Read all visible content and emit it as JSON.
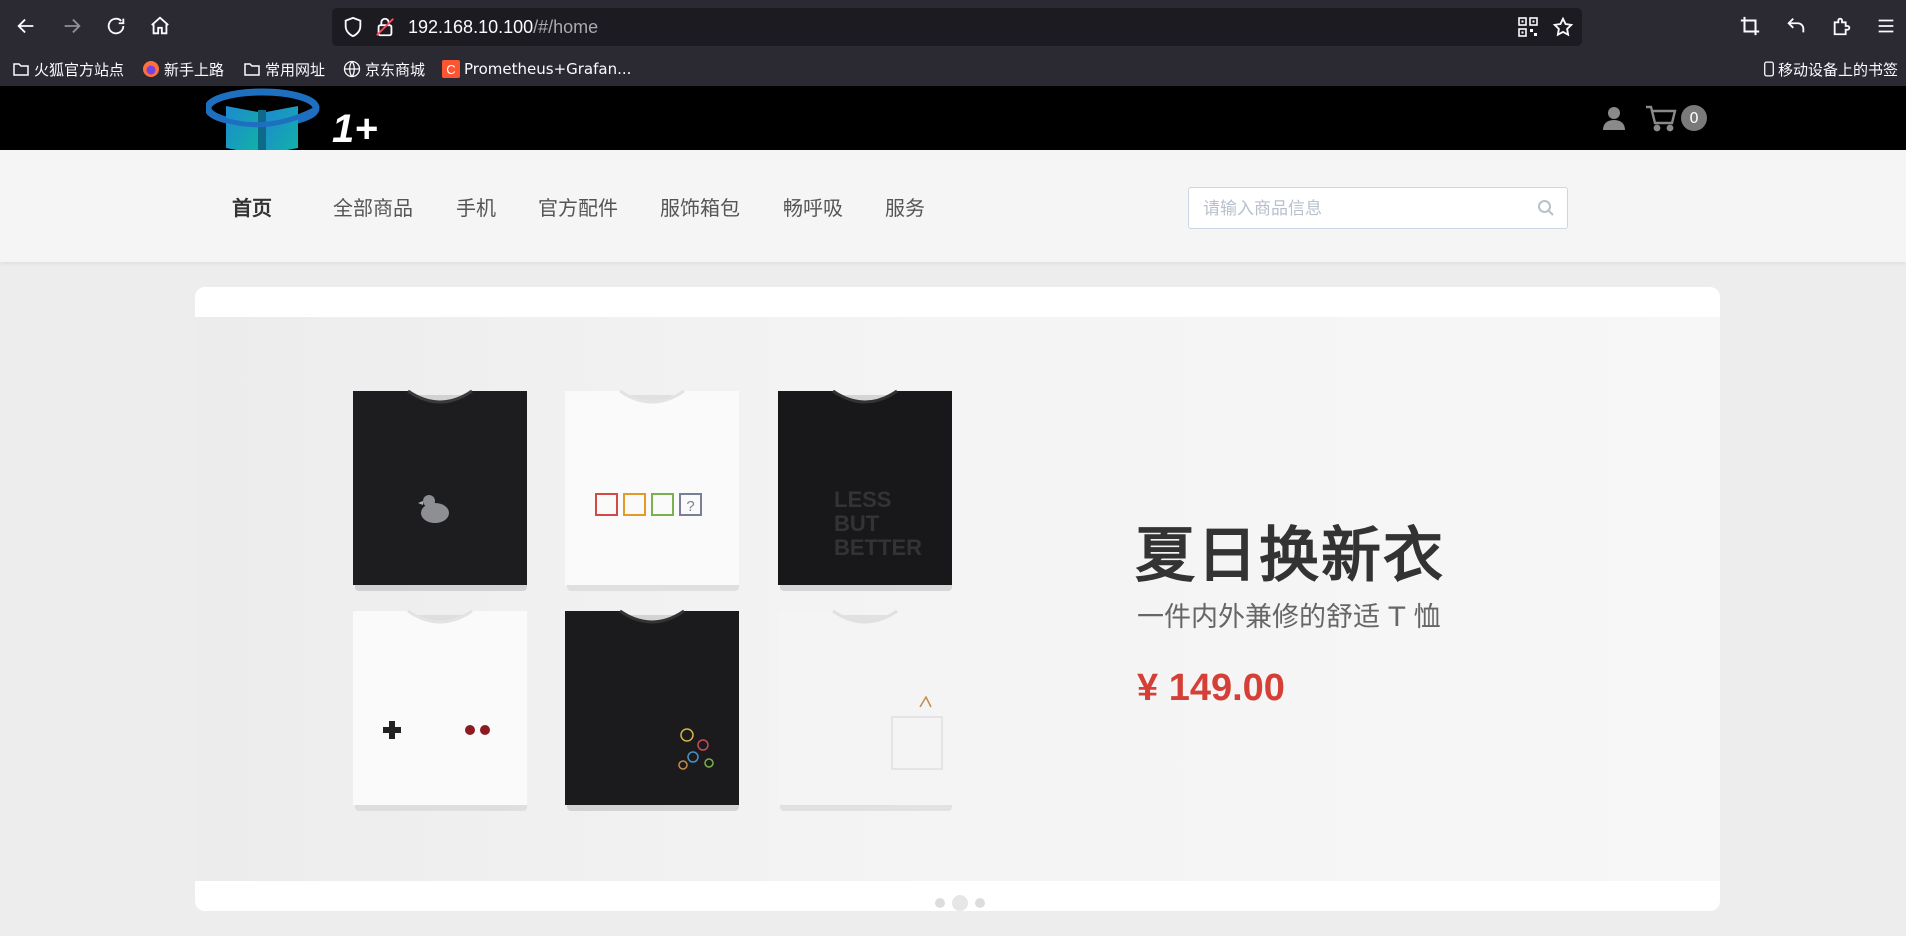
{
  "browser": {
    "url_host": "192.168.10.100",
    "url_path": "/#/home",
    "bookmarks": [
      "火狐官方站点",
      "新手上路",
      "常用网址",
      "京东商城",
      "Prometheus+Grafan..."
    ],
    "mobile_bookmarks": "移动设备上的书签"
  },
  "header": {
    "logo_text": "1+",
    "cart_count": "0"
  },
  "nav": {
    "items": [
      "首页",
      "全部商品",
      "手机",
      "官方配件",
      "服饰箱包",
      "畅呼吸",
      "服务"
    ],
    "active_index": 0,
    "search_placeholder": "请输入商品信息"
  },
  "banner": {
    "title": "夏日换新衣",
    "subtitle": "一件内外兼修的舒适 T 恤",
    "price": "¥ 149.00",
    "shirt_print_text": "LESS BUT BETTER",
    "slides": 3,
    "active_slide": 1
  },
  "colors": {
    "chrome_bg": "#2b2a33",
    "urlbar_bg": "#1c1b22",
    "site_header_bg": "#000000",
    "price_red": "#d44037"
  }
}
